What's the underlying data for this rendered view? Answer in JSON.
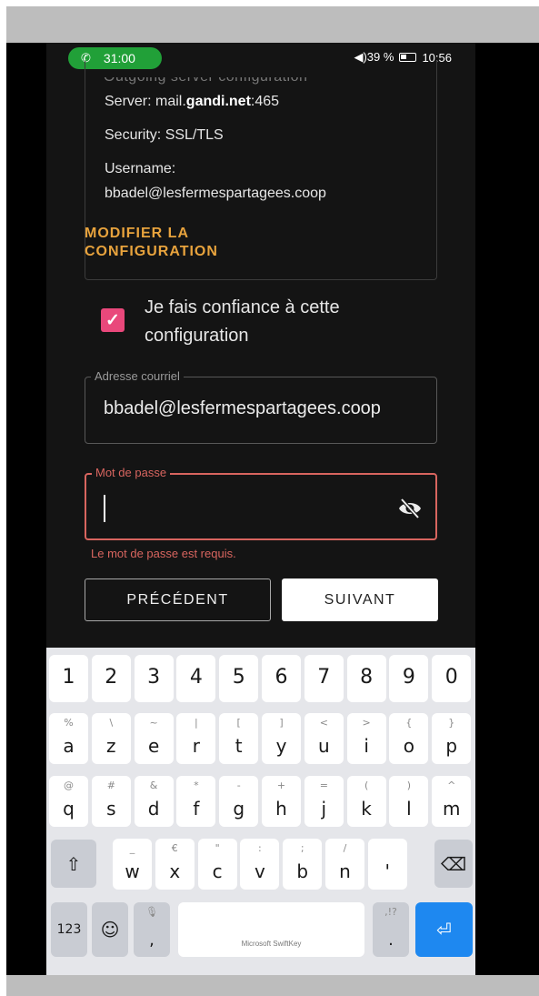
{
  "status_bar": {
    "call_timer": "31:00",
    "right_text_pre": "◀︎)39 %",
    "time": "10:56"
  },
  "config": {
    "title_cut": "Outgoing server configuration",
    "server_label": "Server: mail.",
    "server_bold": "gandi.net",
    "server_port": ":465",
    "security": "Security: SSL/TLS",
    "username_label": "Username:",
    "username_value": "bbadel@lesfermespartagees.coop",
    "modify_line1": "MODIFIER LA",
    "modify_line2": "CONFIGURATION"
  },
  "trust": {
    "checked": true,
    "label": "Je fais confiance à cette configuration"
  },
  "email_field": {
    "legend": "Adresse courriel",
    "value": "bbadel@lesfermespartagees.coop"
  },
  "password_field": {
    "legend": "Mot de passe",
    "value": "",
    "error": "Le mot de passe est requis."
  },
  "nav": {
    "prev": "PRÉCÉDENT",
    "next": "SUIVANT"
  },
  "keyboard": {
    "digits": [
      "1",
      "2",
      "3",
      "4",
      "5",
      "6",
      "7",
      "8",
      "9",
      "0"
    ],
    "row1": [
      [
        "a",
        "%"
      ],
      [
        "z",
        "\\"
      ],
      [
        "e",
        "~"
      ],
      [
        "r",
        "|"
      ],
      [
        "t",
        "["
      ],
      [
        "y",
        "]"
      ],
      [
        "u",
        "<"
      ],
      [
        "i",
        ">"
      ],
      [
        "o",
        "{"
      ],
      [
        "p",
        "}"
      ]
    ],
    "row2": [
      [
        "q",
        "@"
      ],
      [
        "s",
        "#"
      ],
      [
        "d",
        "&"
      ],
      [
        "f",
        "*"
      ],
      [
        "g",
        "-"
      ],
      [
        "h",
        "+"
      ],
      [
        "j",
        "="
      ],
      [
        "k",
        "("
      ],
      [
        "l",
        ")"
      ],
      [
        "m",
        "^"
      ]
    ],
    "row3": [
      [
        "w",
        "_"
      ],
      [
        "x",
        "€"
      ],
      [
        "c",
        "\""
      ],
      [
        "v",
        ":"
      ],
      [
        "b",
        ";"
      ],
      [
        "n",
        "/"
      ],
      [
        "'",
        ""
      ]
    ],
    "numbers_key": "123",
    "comma": ",",
    "period": ".",
    "period_sub": ",!?",
    "space_label": "Microsoft SwiftKey",
    "shift_icon": "shift-icon",
    "backspace_icon": "backspace-icon",
    "enter_icon": "enter-icon",
    "emoji_icon": "emoji-icon",
    "mic_icon": "mic-icon"
  },
  "colors": {
    "accent_orange": "#e8a33d",
    "checkbox_pink": "#e9487b",
    "error_red": "#d8655f",
    "call_green": "#21a038",
    "enter_blue": "#1e88f0"
  }
}
